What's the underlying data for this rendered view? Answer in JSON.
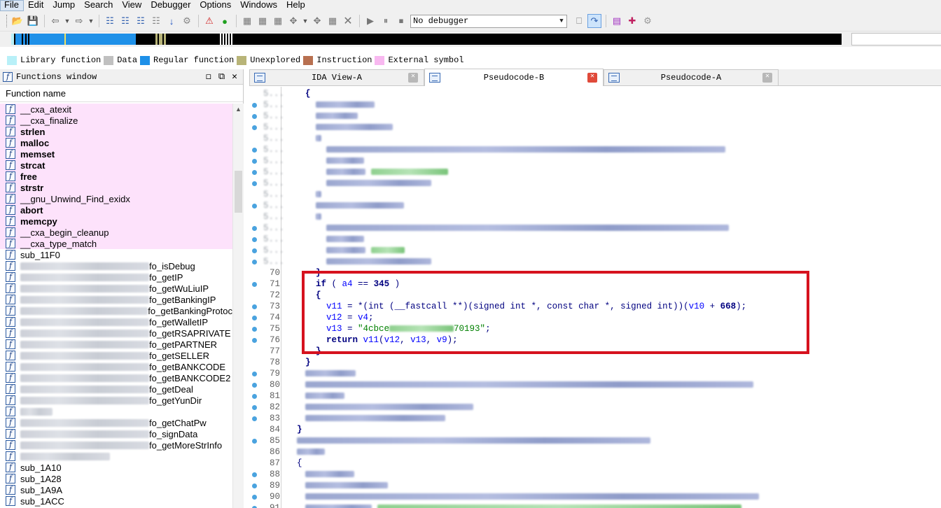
{
  "menu": [
    "File",
    "Edit",
    "Jump",
    "Search",
    "View",
    "Debugger",
    "Options",
    "Windows",
    "Help"
  ],
  "toolbar": {
    "debugger_select": "No debugger"
  },
  "legend": [
    {
      "label": "Library function",
      "color": "#b8f0f8"
    },
    {
      "label": "Data",
      "color": "#c0c0c0"
    },
    {
      "label": "Regular function",
      "color": "#1e90e8"
    },
    {
      "label": "Unexplored",
      "color": "#b8b478"
    },
    {
      "label": "Instruction",
      "color": "#b87050"
    },
    {
      "label": "External symbol",
      "color": "#f8b8f0"
    }
  ],
  "functions_window": {
    "title": "Functions window",
    "column_header": "Function name",
    "items": [
      {
        "name": "__cxa_atexit",
        "pink": true,
        "bold": false,
        "prefix": ""
      },
      {
        "name": "__cxa_finalize",
        "pink": true,
        "bold": false,
        "prefix": ""
      },
      {
        "name": "strlen",
        "pink": true,
        "bold": true,
        "prefix": ""
      },
      {
        "name": "malloc",
        "pink": true,
        "bold": true,
        "prefix": ""
      },
      {
        "name": "memset",
        "pink": true,
        "bold": true,
        "prefix": ""
      },
      {
        "name": "strcat",
        "pink": true,
        "bold": true,
        "prefix": ""
      },
      {
        "name": "free",
        "pink": true,
        "bold": true,
        "prefix": ""
      },
      {
        "name": "strstr",
        "pink": true,
        "bold": true,
        "prefix": ""
      },
      {
        "name": "__gnu_Unwind_Find_exidx",
        "pink": true,
        "bold": false,
        "prefix": ""
      },
      {
        "name": "abort",
        "pink": true,
        "bold": true,
        "prefix": ""
      },
      {
        "name": "memcpy",
        "pink": true,
        "bold": true,
        "prefix": ""
      },
      {
        "name": "__cxa_begin_cleanup",
        "pink": true,
        "bold": false,
        "prefix": ""
      },
      {
        "name": "__cxa_type_match",
        "pink": true,
        "bold": false,
        "prefix": ""
      },
      {
        "name": "sub_11F0",
        "pink": false,
        "bold": false,
        "prefix": ""
      },
      {
        "name": "fo_isDebug",
        "pink": false,
        "bold": false,
        "prefix": "blur"
      },
      {
        "name": "fo_getIP",
        "pink": false,
        "bold": false,
        "prefix": "blur"
      },
      {
        "name": "fo_getWuLiuIP",
        "pink": false,
        "bold": false,
        "prefix": "blur"
      },
      {
        "name": "fo_getBankingIP",
        "pink": false,
        "bold": false,
        "prefix": "blur"
      },
      {
        "name": "fo_getBankingProtoc",
        "pink": false,
        "bold": false,
        "prefix": "blur"
      },
      {
        "name": "fo_getWalletIP",
        "pink": false,
        "bold": false,
        "prefix": "blur"
      },
      {
        "name": "fo_getRSAPRIVATE",
        "pink": false,
        "bold": false,
        "prefix": "blur"
      },
      {
        "name": "fo_getPARTNER",
        "pink": false,
        "bold": false,
        "prefix": "blur"
      },
      {
        "name": "fo_getSELLER",
        "pink": false,
        "bold": false,
        "prefix": "blur"
      },
      {
        "name": "fo_getBANKCODE",
        "pink": false,
        "bold": false,
        "prefix": "blur"
      },
      {
        "name": "fo_getBANKCODE2",
        "pink": false,
        "bold": false,
        "prefix": "blur"
      },
      {
        "name": "fo_getDeal",
        "pink": false,
        "bold": false,
        "prefix": "blur"
      },
      {
        "name": "fo_getYunDir",
        "pink": false,
        "bold": false,
        "prefix": "blur"
      },
      {
        "name": "",
        "pink": false,
        "bold": false,
        "prefix": "blurshort"
      },
      {
        "name": "fo_getChatPw",
        "pink": false,
        "bold": false,
        "prefix": "blur"
      },
      {
        "name": "fo_signData",
        "pink": false,
        "bold": false,
        "prefix": "blur"
      },
      {
        "name": "fo_getMoreStrInfo",
        "pink": false,
        "bold": false,
        "prefix": "blur"
      },
      {
        "name": "",
        "pink": false,
        "bold": false,
        "prefix": "blurmid"
      },
      {
        "name": "sub_1A10",
        "pink": false,
        "bold": false,
        "prefix": ""
      },
      {
        "name": "sub_1A28",
        "pink": false,
        "bold": false,
        "prefix": ""
      },
      {
        "name": "sub_1A9A",
        "pink": false,
        "bold": false,
        "prefix": ""
      },
      {
        "name": "sub_1ACC",
        "pink": false,
        "bold": false,
        "prefix": ""
      }
    ]
  },
  "tabs": [
    {
      "label": "IDA View-A",
      "active": false
    },
    {
      "label": "Pseudocode-B",
      "active": true
    },
    {
      "label": "Pseudocode-A",
      "active": false
    }
  ],
  "code": {
    "highlighted": [
      {
        "line": "71",
        "text": "if ( a4 == 345 )"
      },
      {
        "line": "72",
        "text": "{"
      },
      {
        "line": "73",
        "text": "v11 = *(int (__fastcall **)(signed int *, const char *, signed int))(v10 + 668);"
      },
      {
        "line": "74",
        "text": "v12 = v4;"
      },
      {
        "line": "75",
        "text_prefix": "v13 = \"4cbce",
        "text_suffix": "70193\";"
      },
      {
        "line": "76",
        "text": "return v11(v12, v13, v9);"
      },
      {
        "line": "77",
        "text": "}"
      }
    ],
    "visible_line_numbers": [
      "70",
      "71",
      "72",
      "73",
      "74",
      "75",
      "76",
      "77",
      "78",
      "79",
      "80",
      "81",
      "82",
      "83",
      "84",
      "85",
      "86",
      "87",
      "88",
      "89",
      "90",
      "91"
    ],
    "line_78_text": "}",
    "line_58_text": "{"
  }
}
